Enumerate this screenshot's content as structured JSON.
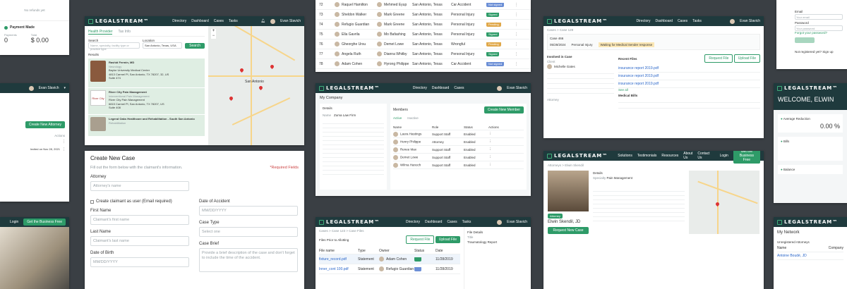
{
  "brand": {
    "logo": "LEGALSTREAM™",
    "accent": "#2e9b68",
    "header_bg": "#1f3a3d"
  },
  "nav": [
    "Directory",
    "Dashboard",
    "Cases",
    "Tasks"
  ],
  "user": {
    "name": "Evan Slavich"
  },
  "p_payment": {
    "no_refunds": "No refunds yet",
    "title": "Payment Made",
    "payments_label": "Payments",
    "payments_value": "0",
    "total_label": "Total",
    "total_value": "$ 0.00"
  },
  "p_dir": {
    "tabs": [
      "Health Provider",
      "Tax Info"
    ],
    "search_label": "Search",
    "search_ph": "Name, specialty, facility type or practice type",
    "location_label": "Location",
    "location_value": "San Antonio, Texas, USA",
    "search_btn": "Search",
    "results_label": "Results",
    "results": [
      {
        "name": "Rashid Fermin, MD",
        "spec": "Neurology",
        "org": "Baylor University Medical Center",
        "addr": "4813 Carmel Pl, San Antonio, TX 78207, 32, US",
        "suite": "Suite 474"
      },
      {
        "name": "River City Pain Management",
        "spec": "Interventional Pain Management",
        "org": "River City Pain Management",
        "addr": "6815 Carmel Pl, San Antonio, TX 78207, US",
        "suite": "Suite 408"
      },
      {
        "name": "Legend Oaks Healthcare and Rehabilitation - South San Antonio",
        "spec": "Rehabilitation",
        "org": "",
        "addr": "",
        "suite": ""
      }
    ],
    "map_city": "San Antonio"
  },
  "p_list": {
    "rows": [
      {
        "no": "72",
        "name": "Raquel Hamilton",
        "owner": "Mehmed Eyup",
        "loc": "San Antonio, Texas",
        "type": "Car Accident",
        "status": "Not signed",
        "color": "#6c8fd6"
      },
      {
        "no": "73",
        "name": "Sheldon Walker",
        "owner": "Mark Greene",
        "loc": "San Antonio, Texas",
        "type": "Personal Injury",
        "status": "Signed",
        "color": "#2e9b68"
      },
      {
        "no": "74",
        "name": "Refugio Guardian",
        "owner": "Mark Greene",
        "loc": "San Antonio, Texas",
        "type": "Personal Injury",
        "status": "Pending",
        "color": "#e0a84a"
      },
      {
        "no": "75",
        "name": "Ella Gavrila",
        "owner": "Mo Bafashing",
        "loc": "San Antonio, Texas",
        "type": "Personal Injury",
        "status": "Signed",
        "color": "#2e9b68"
      },
      {
        "no": "76",
        "name": "Gheorghe Ursu",
        "owner": "Demet Lowe",
        "loc": "San Antonio, Texas",
        "type": "Wrongful",
        "status": "Pending",
        "color": "#e0a84a"
      },
      {
        "no": "77",
        "name": "Angela Ruth",
        "owner": "Dianna Whitby",
        "loc": "San Antonio, Texas",
        "type": "Personal Injury",
        "status": "Signed",
        "color": "#2e9b68"
      },
      {
        "no": "78",
        "name": "Adam Cohen",
        "owner": "Hyrong Philippe",
        "loc": "San Antonio, Texas",
        "type": "Car Accident",
        "status": "Not signed",
        "color": "#6c8fd6"
      }
    ]
  },
  "p_case": {
    "crumb": "Cases > Case 128",
    "case_no": "Case 466",
    "created": "05/28/2024",
    "type": "Personal Injury",
    "waiting": "Waiting for Medical Sender response",
    "involved": "Involved in Case",
    "client_label": "Client",
    "client_name": "Michelle Gates",
    "recent_files": "Recent Files",
    "request_btn": "Request File",
    "upload_btn": "Upload File",
    "files": [
      "insurance report 2019.pdf",
      "insurance report 2019.pdf",
      "insurance report 2019.pdf"
    ],
    "see_all": "See all",
    "medical_bills": "Medical Bills",
    "attorney_label": "Attorney"
  },
  "p_welcome": {
    "email_label": "Email",
    "email_ph": "Your email",
    "password_label": "Password",
    "password_ph": "Your password",
    "forgot": "Forgot your password?",
    "no_account": "Not registered yet? Sign up",
    "welcome": "WELCOME, ELWIN",
    "avg_label": "Average Reduction",
    "avg_value": "0.00 %",
    "bills_label": "Bills",
    "balance_label": "Balance"
  },
  "p_left": {
    "add_btn": "Create New Attorney",
    "invited": "Invited on Nov 28, 2021",
    "login": "Login",
    "get_free": "Get the Business Free"
  },
  "p_company": {
    "title": "My Company",
    "details": "Details",
    "company_name": "Zuma Law Firm",
    "members": "Members",
    "new_member_btn": "Create New Member",
    "tabs": [
      "Active",
      "Inactive"
    ],
    "cols": [
      "Name",
      "Role",
      "Status",
      "Actions"
    ],
    "members_list": [
      {
        "name": "Laura Hastings",
        "role": "Support Staff",
        "status": "Enabled"
      },
      {
        "name": "Henry Philippe",
        "role": "Attorney",
        "status": "Enabled"
      },
      {
        "name": "Renee Max",
        "role": "Support Staff",
        "status": "Enabled"
      },
      {
        "name": "Demet Lowe",
        "role": "Support Staff",
        "status": "Enabled"
      },
      {
        "name": "Wilma Hanoch",
        "role": "Support Staff",
        "status": "Enabled"
      }
    ]
  },
  "p_create": {
    "title": "Create New Case",
    "subtitle": "Fill out the form below with the claimant's information.",
    "required": "*Required Fields",
    "attorney_label": "Attorney",
    "attorney_ph": "Attorney's name",
    "create_user_cb": "Create claimant as user (Email required)",
    "first_label": "First Name",
    "first_ph": "Claimant's first name",
    "last_label": "Last Name",
    "last_ph": "Claimant's last name",
    "dob_label": "Date of Birth",
    "dob_ph": "MM/DD/YYYY",
    "acc_label": "Date of Accident",
    "acc_ph": "MM/DD/YYYY",
    "type_label": "Case Type",
    "type_ph": "Select one",
    "brief_label": "Case Brief",
    "brief_ph": "Provide a brief description of the case and don't forget to include the time of the accident."
  },
  "p_files": {
    "crumb": "Cases > Case 123 > Case Files",
    "title": "Files Prior to Allotting",
    "request_btn": "Request File",
    "upload_btn": "Upload File",
    "cols": [
      "File name",
      "Type",
      "Owner",
      "Status",
      "Date"
    ],
    "rows": [
      {
        "name": "fixture_record.pdf",
        "type": "Statement",
        "owner": "Adam Cohen",
        "date": "11/28/2019"
      },
      {
        "name": "Inner_cont 100.pdf",
        "type": "Statement",
        "owner": "Refugio Guardian",
        "date": "11/28/2019"
      }
    ],
    "details": "File Details",
    "detail_title": "Traumatology Report"
  },
  "p_attorney": {
    "crumb": "Attorneys > Elwin Skendil",
    "name": "Elwin Skendil, JD",
    "badge": "Attorney",
    "req_btn": "Request New Case",
    "details": "Details",
    "specialty": "Pain Management",
    "nav": [
      "Solutions",
      "Testimonials",
      "Resources",
      "About Us",
      "Contact Us"
    ],
    "login": "Login",
    "free_btn": "Get the Business Free"
  },
  "p_network": {
    "title": "My Network",
    "unregistered": "Unregistered Attorneys",
    "col_name": "Name",
    "col_company": "Company",
    "attorney": "Antoine Boudé, JD"
  }
}
